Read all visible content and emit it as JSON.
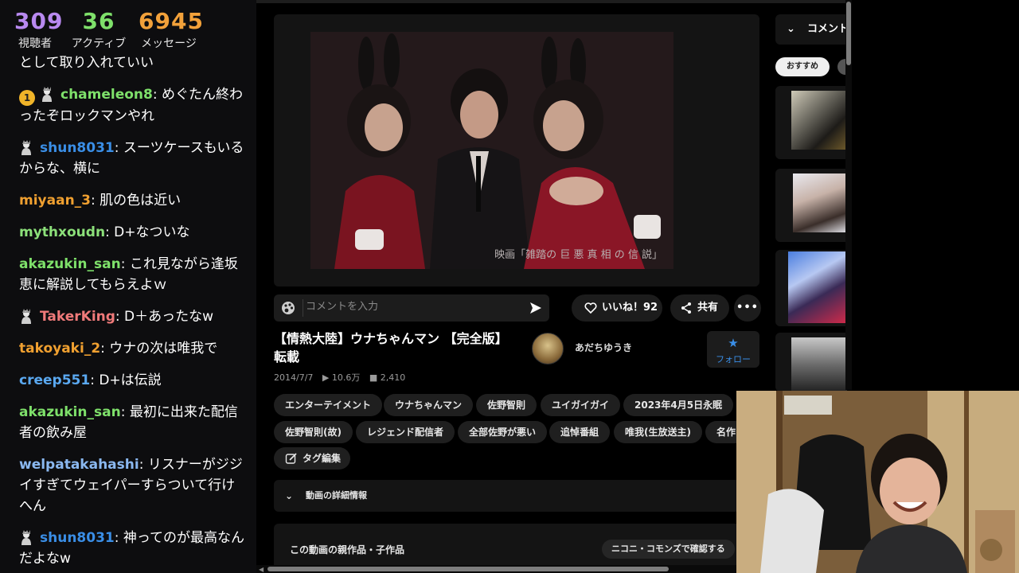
{
  "stats": [
    {
      "value": "309",
      "label": "視聴者",
      "color": "#b889f0"
    },
    {
      "value": "36",
      "label": "アクティブ",
      "color": "#7ee06a"
    },
    {
      "value": "6945",
      "label": "メッセージ",
      "color": "#f2a13a"
    }
  ],
  "chat": {
    "messages": [
      {
        "user": "",
        "text": "として取り入れていい",
        "color": "#ffffff",
        "badge": "",
        "avatar": false
      },
      {
        "user": "chameleon8",
        "text": ": めぐたん終わったぞロックマンやれ",
        "color": "#7ee06a",
        "badge": "1",
        "avatar": true
      },
      {
        "user": "shun8031",
        "text": ": スーツケースもいるからな、横に",
        "color": "#3a8ee6",
        "badge": "",
        "avatar": true
      },
      {
        "user": "miyaan_3",
        "text": ": 肌の色は近い",
        "color": "#f0a030",
        "badge": "",
        "avatar": false
      },
      {
        "user": "mythxoudn",
        "text": ": D+なついな",
        "color": "#8ce07a",
        "badge": "",
        "avatar": false
      },
      {
        "user": "akazukin_san",
        "text": ": これ見ながら逢坂恵に解説してもらえよｗ",
        "color": "#7ee06a",
        "badge": "",
        "avatar": false
      },
      {
        "user": "TakerKing",
        "text": ": D＋あったなw",
        "color": "#f07a7a",
        "badge": "",
        "avatar": true
      },
      {
        "user": "takoyaki_2",
        "text": ": ウナの次は唯我で",
        "color": "#f0a030",
        "badge": "",
        "avatar": false
      },
      {
        "user": "creep551",
        "text": ": D+は伝説",
        "color": "#5aa8f0",
        "badge": "",
        "avatar": false
      },
      {
        "user": "akazukin_san",
        "text": ": 最初に出来た配信者の飲み屋",
        "color": "#7ee06a",
        "badge": "",
        "avatar": false
      },
      {
        "user": "welpatakahashi",
        "text": ": リスナーがジジイすぎてウェイパーすらついて行けへん",
        "color": "#8ab8f0",
        "badge": "",
        "avatar": false
      },
      {
        "user": "shun8031",
        "text": ": 神ってのが最高なんだよなw",
        "color": "#3a8ee6",
        "badge": "",
        "avatar": true
      }
    ]
  },
  "video": {
    "caption": "映画「雑踏の 巨 悪 真 相 の 信 説」",
    "comment_placeholder": "コメントを入力",
    "like_label": "いいね！92",
    "share_label": "共有",
    "more_label": "•••",
    "title": "【情熱大陸】ウナちゃんマン 【完全版】 転載",
    "date": "2014/7/7",
    "views": "▶ 10.6万",
    "comments": "■ 2,410",
    "channel_name": "あだちゆうき",
    "follow_label": "フォロー",
    "tags_row1": [
      "エンターテイメント",
      "ウナちゃんマン",
      "佐野智則",
      "ユイガイガイ",
      "2023年4月5日永眠"
    ],
    "tags_row2": [
      "佐野智則(故)",
      "レジェンド配信者",
      "全部佐野が悪い",
      "追悼番組",
      "唯我(生放送主)",
      "名作"
    ],
    "tag_edit_label": "タグ編集",
    "details_label": "動画の詳細情報",
    "parent_label": "この動画の親作品・子作品",
    "commons_button": "ニコニ・コモンズで確認する"
  },
  "side": {
    "comment_header": "コメント",
    "recommend_pill": "おすすめ"
  },
  "colors": {
    "accent_blue": "#3a8ee6",
    "panel": "#141414"
  }
}
